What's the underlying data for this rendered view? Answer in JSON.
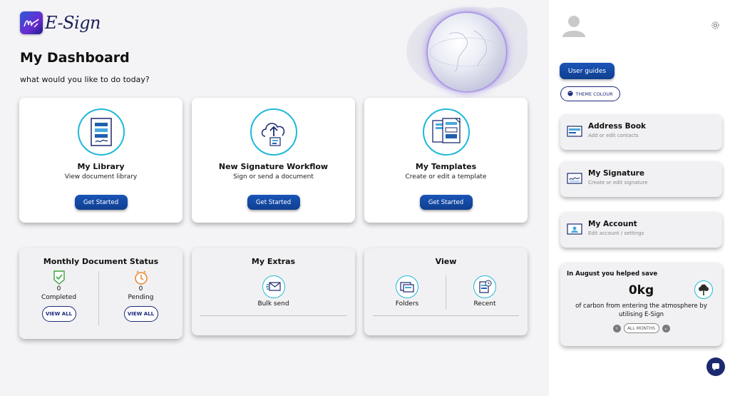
{
  "app": {
    "logo_text": "E-Sign"
  },
  "header": {
    "title": "My Dashboard",
    "subtitle": "what would you like to do today?"
  },
  "actions": [
    {
      "title": "My Library",
      "subtitle": "View document library",
      "button": "Get Started",
      "icon": "library-document-icon"
    },
    {
      "title": "New Signature Workflow",
      "subtitle": "Sign or send a document",
      "button": "Get Started",
      "icon": "cloud-upload-icon"
    },
    {
      "title": "My Templates",
      "subtitle": "Create or edit a template",
      "button": "Get Started",
      "icon": "templates-icon"
    }
  ],
  "status": {
    "title": "Monthly Document Status",
    "completed": {
      "count": "0",
      "label": "Completed",
      "button": "VIEW ALL",
      "icon": "check-shield-icon"
    },
    "pending": {
      "count": "0",
      "label": "Pending",
      "button": "VIEW ALL",
      "icon": "clock-icon"
    }
  },
  "extras": {
    "title": "My Extras",
    "items": [
      {
        "label": "Bulk send",
        "icon": "bulk-send-icon"
      }
    ]
  },
  "view": {
    "title": "View",
    "items": [
      {
        "label": "Folders",
        "icon": "folders-icon"
      },
      {
        "label": "Recent",
        "icon": "recent-icon"
      }
    ]
  },
  "sidebar": {
    "user_guides": "User guides",
    "theme_colour": "THEME COLOUR",
    "cards": [
      {
        "title": "Address Book",
        "subtitle": "Add or edit contacts",
        "icon": "address-book-icon"
      },
      {
        "title": "My Signature",
        "subtitle": "Create or edit signature",
        "icon": "signature-icon"
      },
      {
        "title": "My Account",
        "subtitle": "Edit account / settings",
        "icon": "account-icon"
      }
    ],
    "carbon": {
      "heading": "In August you helped save",
      "value": "0kg",
      "text": "of carbon from entering the atmosphere by utilising E-Sign",
      "all_months": "ALL MONTHS"
    }
  },
  "colors": {
    "accent": "#1fb9d9",
    "primary_button": "#1a55b8",
    "navy": "#1b2a7a"
  }
}
